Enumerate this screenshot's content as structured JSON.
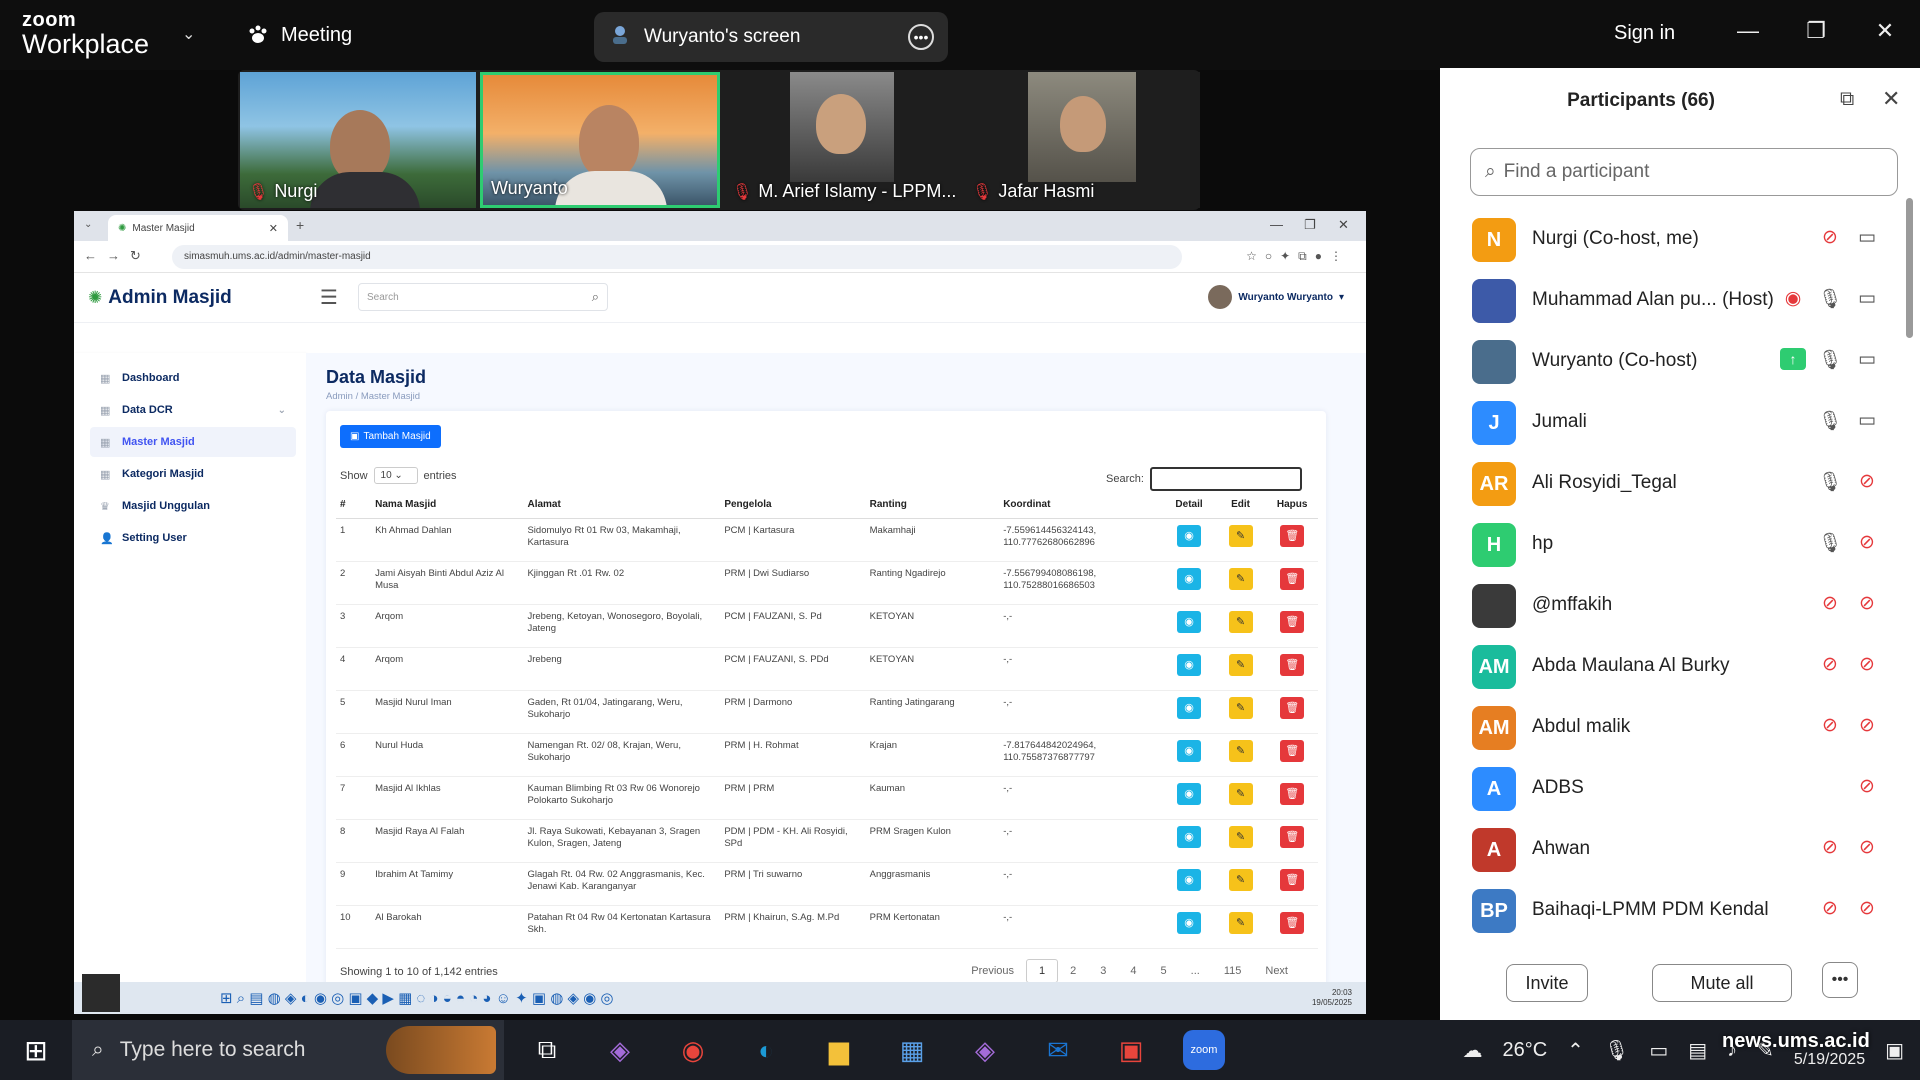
{
  "zoom": {
    "logo_top": "zoom",
    "logo_bottom": "Workplace",
    "meeting_label": "Meeting",
    "share_label": "Wuryanto's screen",
    "sign_in": "Sign in"
  },
  "videos": [
    {
      "name": "Nurgi",
      "muted": true
    },
    {
      "name": "Wuryanto",
      "muted": false
    },
    {
      "name": "M. Arief Islamy - LPPM...",
      "muted": true
    },
    {
      "name": "Jafar Hasmi",
      "muted": true
    }
  ],
  "browser": {
    "tab_title": "Master Masjid",
    "url": "simasmuh.ums.ac.id/admin/master-masjid"
  },
  "app": {
    "logo": "Admin Masjid",
    "search_placeholder": "Search",
    "user": "Wuryanto Wuryanto",
    "sidebar": [
      {
        "label": "Dashboard",
        "active": false
      },
      {
        "label": "Data DCR",
        "active": false
      },
      {
        "label": "Master Masjid",
        "active": true
      },
      {
        "label": "Kategori Masjid",
        "active": false
      },
      {
        "label": "Masjid Unggulan",
        "active": false
      },
      {
        "label": "Setting User",
        "active": false
      }
    ],
    "page_title": "Data Masjid",
    "breadcrumb_1": "Admin",
    "breadcrumb_2": "Master Masjid",
    "add_button": "Tambah Masjid",
    "show_label": "Show",
    "show_value": "10",
    "entries_label": "entries",
    "search_label": "Search:",
    "columns": [
      "#",
      "Nama Masjid",
      "Alamat",
      "Pengelola",
      "Ranting",
      "Koordinat",
      "Detail",
      "Edit",
      "Hapus"
    ],
    "rows": [
      [
        "1",
        "Kh Ahmad Dahlan",
        "Sidomulyo Rt 01 Rw 03, Makamhaji, Kartasura",
        "PCM | Kartasura",
        "Makamhaji",
        "-7.559614456324143, 110.77762680662896"
      ],
      [
        "2",
        "Jami Aisyah Binti Abdul Aziz Al Musa",
        "Kjinggan Rt .01 Rw. 02",
        "PRM | Dwi Sudiarso",
        "Ranting Ngadirejo",
        "-7.556799408086198, 110.75288016686503"
      ],
      [
        "3",
        "Arqom",
        "Jrebeng, Ketoyan, Wonosegoro, Boyolali, Jateng",
        "PCM | FAUZANI, S. Pd",
        "KETOYAN",
        "-,-"
      ],
      [
        "4",
        "Arqom",
        "Jrebeng",
        "PCM | FAUZANI, S. PDd",
        "KETOYAN",
        "-,-"
      ],
      [
        "5",
        "Masjid Nurul Iman",
        "Gaden, Rt 01/04, Jatingarang, Weru, Sukoharjo",
        "PRM | Darmono",
        "Ranting Jatingarang",
        "-,-"
      ],
      [
        "6",
        "Nurul Huda",
        "Namengan Rt. 02/ 08, Krajan, Weru, Sukoharjo",
        "PRM | H. Rohmat",
        "Krajan",
        "-7.817644842024964, 110.75587376877797"
      ],
      [
        "7",
        "Masjid Al Ikhlas",
        "Kauman Blimbing Rt 03 Rw 06 Wonorejo Polokarto Sukoharjo",
        "PRM | PRM",
        "Kauman",
        "-,-"
      ],
      [
        "8",
        "Masjid Raya Al Falah",
        "Jl. Raya Sukowati, Kebayanan 3, Sragen Kulon, Sragen, Jateng",
        "PDM | PDM - KH. Ali Rosyidi, SPd",
        "PRM Sragen Kulon",
        "-,-"
      ],
      [
        "9",
        "Ibrahim At Tamimy",
        "Glagah Rt. 04 Rw. 02 Anggrasmanis, Kec. Jenawi Kab. Karanganyar",
        "PRM | Tri suwarno",
        "Anggrasmanis",
        "-,-"
      ],
      [
        "10",
        "Al Barokah",
        "Patahan Rt 04 Rw 04 Kertonatan Kartasura Skh.",
        "PRM | Khairun, S.Ag. M.Pd",
        "PRM Kertonatan",
        "-,-"
      ]
    ],
    "info": "Showing 1 to 10 of 1,142 entries",
    "pager": [
      "Previous",
      "1",
      "2",
      "3",
      "4",
      "5",
      "...",
      "115",
      "Next"
    ],
    "inner_clock_time": "20:03",
    "inner_clock_date": "19/05/2025"
  },
  "participants": {
    "title": "Participants (66)",
    "find_placeholder": "Find a participant",
    "list": [
      {
        "initials": "N",
        "name": "Nurgi (Co-host, me)",
        "color": "#f39c12",
        "mic": "muted",
        "video": "on"
      },
      {
        "initials": "",
        "name": "Muhammad Alan pu...  (Host)",
        "color": "#3d5aa8",
        "mic": "on",
        "video": "on",
        "recording": true
      },
      {
        "initials": "",
        "name": "Wuryanto (Co-host)",
        "color": "#4a6d8c",
        "mic": "on",
        "video": "on",
        "sharing": true
      },
      {
        "initials": "J",
        "name": "Jumali",
        "color": "#2d8cff",
        "mic": "on",
        "video": "on"
      },
      {
        "initials": "AR",
        "name": "Ali Rosyidi_Tegal",
        "color": "#f39c12",
        "mic": "on",
        "video": "off"
      },
      {
        "initials": "H",
        "name": "hp",
        "color": "#2ecc71",
        "mic": "on",
        "video": "off"
      },
      {
        "initials": "",
        "name": "@mffakih",
        "color": "#3a3a3a",
        "mic": "muted",
        "video": "off"
      },
      {
        "initials": "AM",
        "name": "Abda Maulana Al Burky",
        "color": "#1abc9c",
        "mic": "muted",
        "video": "off"
      },
      {
        "initials": "AM",
        "name": "Abdul malik",
        "color": "#e67e22",
        "mic": "muted",
        "video": "off"
      },
      {
        "initials": "A",
        "name": "ADBS",
        "color": "#2d8cff",
        "mic": "none",
        "video": "muted_only"
      },
      {
        "initials": "A",
        "name": "Ahwan",
        "color": "#c0392b",
        "mic": "muted",
        "video": "off"
      },
      {
        "initials": "BP",
        "name": "Baihaqi-LPMM PDM Kendal",
        "color": "#3d7ac4",
        "mic": "muted",
        "video": "off"
      }
    ],
    "invite": "Invite",
    "mute_all": "Mute all"
  },
  "taskbar": {
    "search_placeholder": "Type here to search",
    "temperature": "26°C",
    "date": "5/19/2025",
    "watermark": "news.ums.ac.id"
  }
}
